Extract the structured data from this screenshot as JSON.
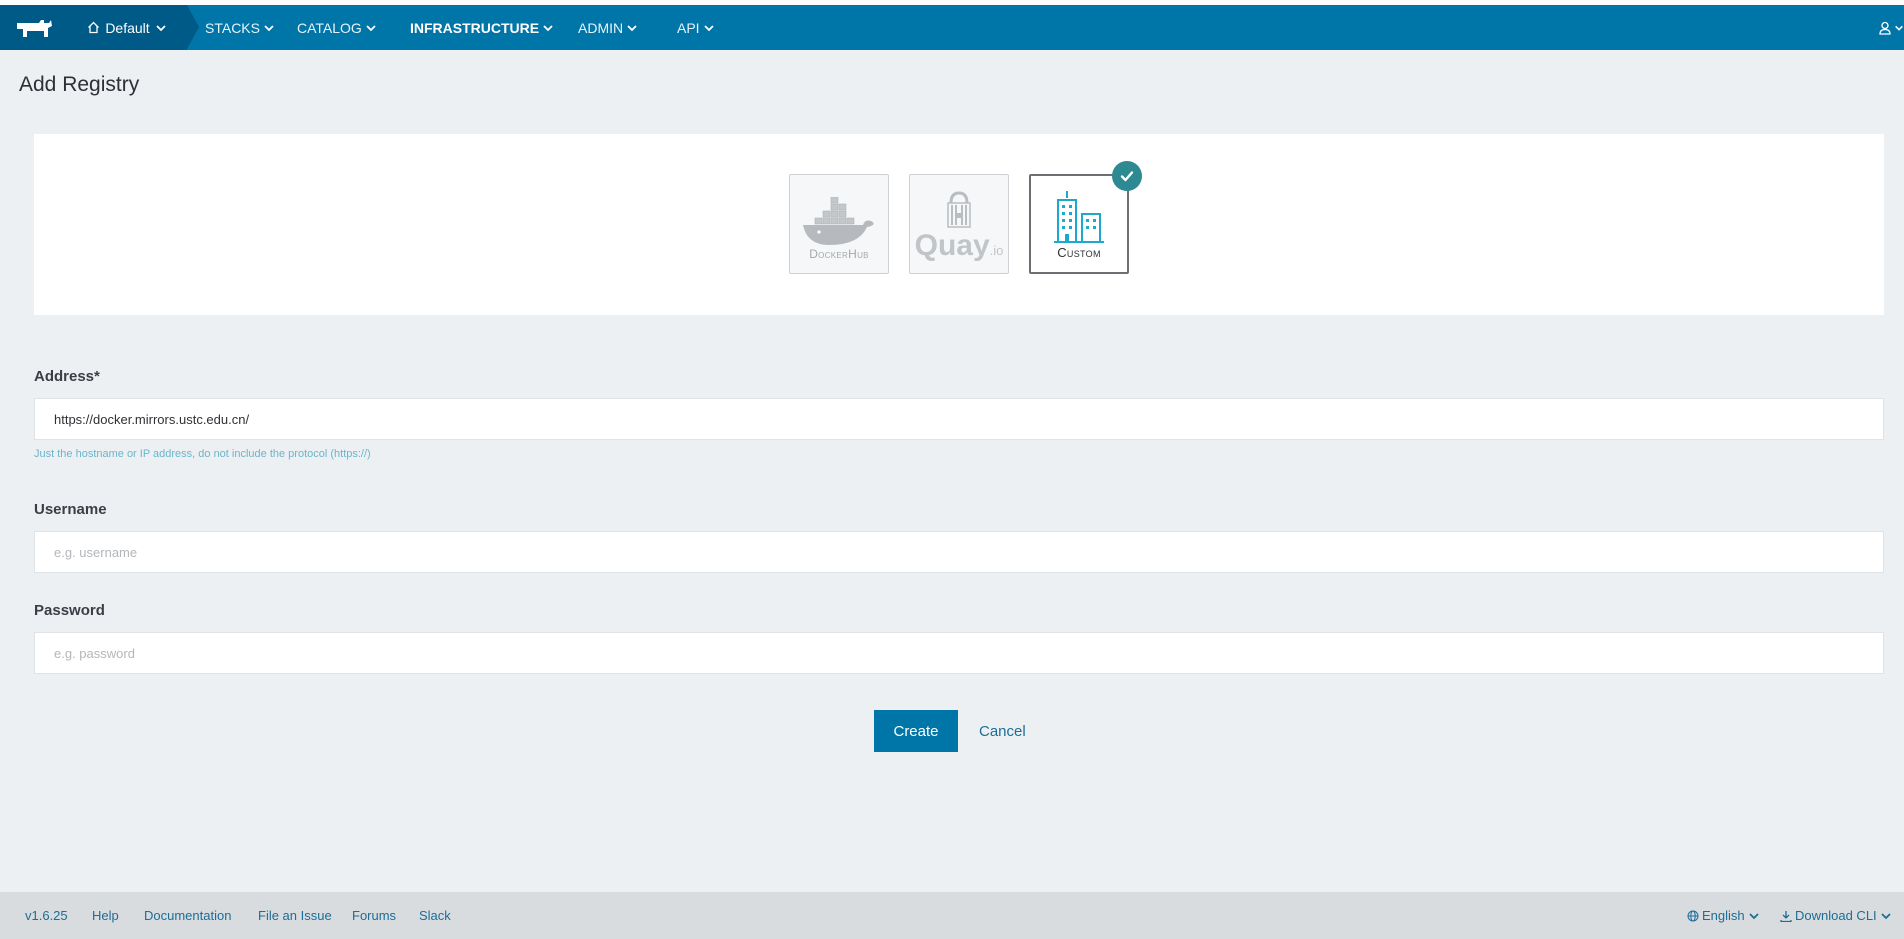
{
  "header": {
    "environment": "Default",
    "nav": [
      {
        "label": "STACKS"
      },
      {
        "label": "CATALOG"
      },
      {
        "label": "INFRASTRUCTURE"
      },
      {
        "label": "ADMIN"
      },
      {
        "label": "API"
      }
    ],
    "active_nav": "INFRASTRUCTURE"
  },
  "page": {
    "title": "Add Registry"
  },
  "drivers": [
    {
      "label": "DockerHub",
      "icon": "docker-whale-icon",
      "selected": false
    },
    {
      "label": "Quay",
      "sublabel": ".io",
      "icon": "quay-icon",
      "selected": false
    },
    {
      "label": "Custom",
      "icon": "buildings-icon",
      "selected": true
    }
  ],
  "form": {
    "address": {
      "label": "Address*",
      "value": "https://docker.mirrors.ustc.edu.cn/",
      "help": "Just the hostname or IP address, do not include the protocol (https://)"
    },
    "username": {
      "label": "Username",
      "value": "",
      "placeholder": "e.g. username"
    },
    "password": {
      "label": "Password",
      "value": "",
      "placeholder": "e.g. password"
    },
    "create_label": "Create",
    "cancel_label": "Cancel"
  },
  "footer": {
    "version": "v1.6.25",
    "links": [
      "Help",
      "Documentation",
      "File an Issue",
      "Forums",
      "Slack"
    ],
    "language": "English",
    "download": "Download CLI"
  },
  "colors": {
    "header_bg": "#0075a8",
    "header_dark": "#005a87",
    "page_bg": "#edf0f2",
    "primary": "#0075a8",
    "check_badge": "#2d8a92"
  }
}
